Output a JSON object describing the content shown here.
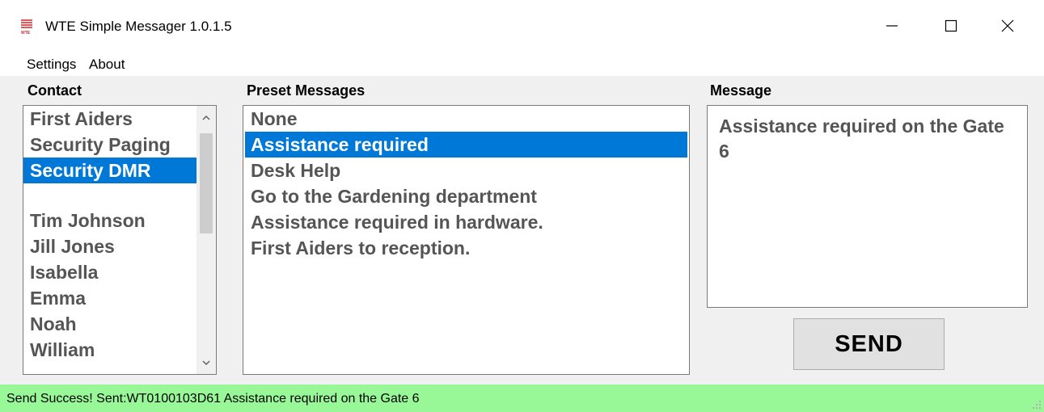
{
  "window": {
    "title": "WTE Simple Messager 1.0.1.5",
    "icon_label": "WTE"
  },
  "menu": {
    "items": [
      "Settings",
      "About"
    ]
  },
  "contact": {
    "label": "Contact",
    "items": [
      "First Aiders",
      "Security Paging",
      "Security DMR",
      "",
      "Tim Johnson",
      "Jill Jones",
      "Isabella",
      "Emma",
      "Noah",
      "William"
    ],
    "selected": "Security DMR"
  },
  "preset": {
    "label": "Preset Messages",
    "items": [
      "None",
      "Assistance required",
      "Desk Help",
      "Go to the Gardening department",
      "Assistance required in hardware.",
      "First Aiders to reception."
    ],
    "selected": "Assistance required"
  },
  "message": {
    "label": "Message",
    "text": "Assistance required on the Gate 6"
  },
  "send": {
    "label": "SEND"
  },
  "status": {
    "text": "Send Success!  Sent:WT0100103D61 Assistance required on the Gate 6"
  },
  "colors": {
    "selection": "#0078d7",
    "status_bg": "#98f898",
    "list_text": "#555555"
  }
}
